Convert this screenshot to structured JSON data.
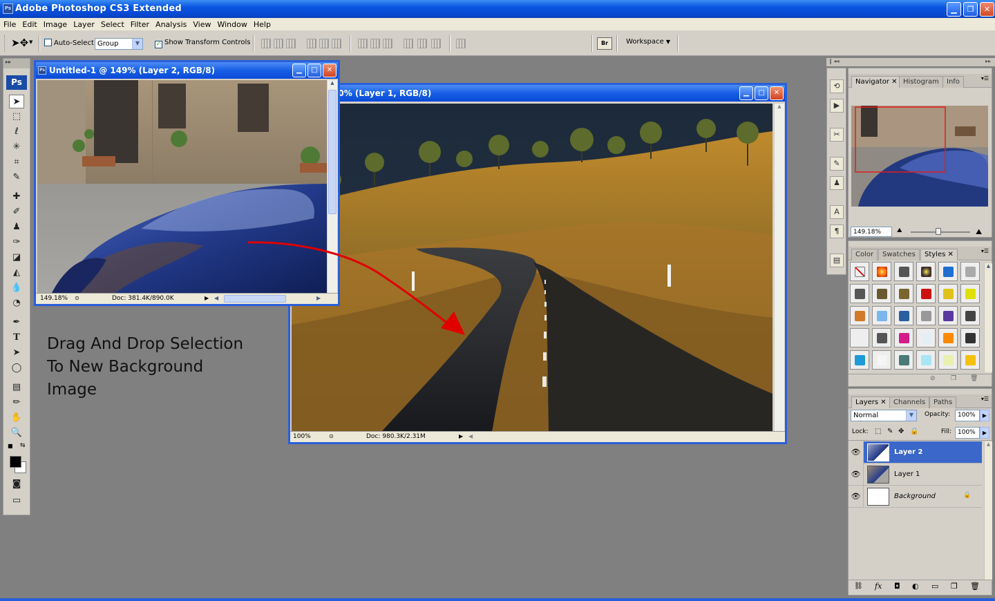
{
  "app": {
    "title": "Adobe Photoshop CS3 Extended",
    "icon": "Ps"
  },
  "menu": [
    "File",
    "Edit",
    "Image",
    "Layer",
    "Select",
    "Filter",
    "Analysis",
    "View",
    "Window",
    "Help"
  ],
  "options": {
    "auto_select_label": "Auto-Select:",
    "auto_select_value": "Group",
    "show_transform_label": "Show Transform Controls",
    "workspace_label": "Workspace",
    "bridge_label": "Br"
  },
  "toolbox": {
    "logo": "Ps"
  },
  "doc1": {
    "title": "Untitled-1 @ 149% (Layer 2, RGB/8)",
    "zoom": "149.18%",
    "doc_size": "Doc: 381.4K/890.0K"
  },
  "doc2": {
    "title": "-2 @ 100% (Layer 1, RGB/8)",
    "zoom": "100%",
    "doc_size": "Doc: 980.3K/2.31M"
  },
  "caption": [
    "Drag And Drop Selection",
    "To New Background",
    "Image"
  ],
  "navigator": {
    "tabs": [
      "Navigator",
      "Histogram",
      "Info"
    ],
    "zoom": "149.18%"
  },
  "styles_panel": {
    "tabs": [
      "Color",
      "Swatches",
      "Styles"
    ]
  },
  "layers_panel": {
    "tabs": [
      "Layers",
      "Channels",
      "Paths"
    ],
    "blend_mode": "Normal",
    "opacity_label": "Opacity:",
    "opacity": "100%",
    "lock_label": "Lock:",
    "fill_label": "Fill:",
    "fill": "100%",
    "layers": [
      {
        "name": "Layer 2",
        "selected": true
      },
      {
        "name": "Layer 1",
        "selected": false
      },
      {
        "name": "Background",
        "selected": false
      }
    ]
  },
  "colors": {
    "xp_blue": "#0a55e0",
    "selection": "#3a67c9",
    "arrow": "#e00000"
  }
}
